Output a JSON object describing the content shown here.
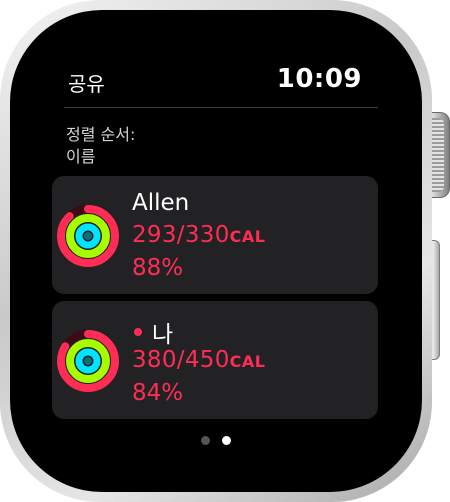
{
  "header": {
    "title": "공유",
    "time": "10:09"
  },
  "sort": {
    "label": "정렬 순서:",
    "value": "이름"
  },
  "friends": [
    {
      "name": "Allen",
      "calories": "293/330",
      "calories_unit": "CAL",
      "percent": "88%",
      "move_progress": 0.88,
      "has_dot": false,
      "icon": "activity-rings-icon"
    },
    {
      "name": "나",
      "calories": "380/450",
      "calories_unit": "CAL",
      "percent": "84%",
      "move_progress": 0.84,
      "has_dot": true,
      "icon": "activity-rings-icon"
    }
  ],
  "pager": {
    "pages": 2,
    "active_index": 1
  },
  "colors": {
    "move": "#ff2d55",
    "exercise": "#a5ff00",
    "stand": "#00e5ff",
    "card_bg": "#222224",
    "screen_bg": "#000000"
  }
}
